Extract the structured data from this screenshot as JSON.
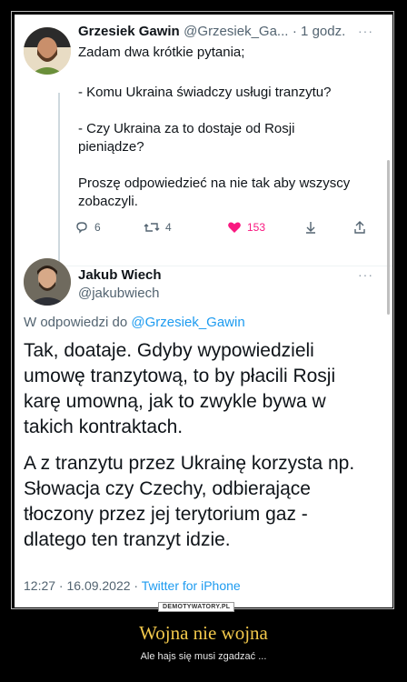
{
  "tweet1": {
    "author_name": "Grzesiek Gawin",
    "author_handle": "@Grzesiek_Ga...",
    "time": "· 1 godz.",
    "lines": [
      "Zadam dwa krótkie pytania;",
      "- Komu Ukraina świadczy usługi tranzytu?",
      "- Czy Ukraina za to dostaje od Rosji",
      "pieniądze?",
      "Proszę odpowiedzieć na nie tak aby wszyscy",
      "zobaczyli."
    ],
    "stats": {
      "replies": "6",
      "retweets": "4",
      "likes": "153"
    }
  },
  "tweet2": {
    "author_name": "Jakub Wiech",
    "author_handle": "@jakubwiech",
    "replying_prefix": "W odpowiedzi do",
    "replying_to": "@Grzesiek_Gawin",
    "para1": [
      "Tak, doataje. Gdyby wypowiedzieli",
      "umowę tranzytową, to by płacili Rosji",
      "karę umowną, jak to zwykle bywa w",
      "takich kontraktach."
    ],
    "para2": [
      "A z tranzytu przez Ukrainę korzysta np.",
      "Słowacja czy Czechy, odbierające",
      "tłoczony przez jej terytorium gaz -",
      "dlatego ten tranzyt idzie."
    ],
    "timestamp": "12:27 · 16.09.2022 ·",
    "source": "Twitter for iPhone"
  },
  "watermark": "DEMOTYWATORY.PL",
  "poster": {
    "title": "Wojna nie wojna",
    "subtitle": "Ale hajs się musi zgadzać ..."
  },
  "colors": {
    "accent": "#1d9bf0",
    "like": "#f91880",
    "title": "#f2c84b"
  },
  "icons": [
    "reply-icon",
    "retweet-icon",
    "heart-icon",
    "bookmark-icon",
    "share-icon",
    "more-icon"
  ]
}
